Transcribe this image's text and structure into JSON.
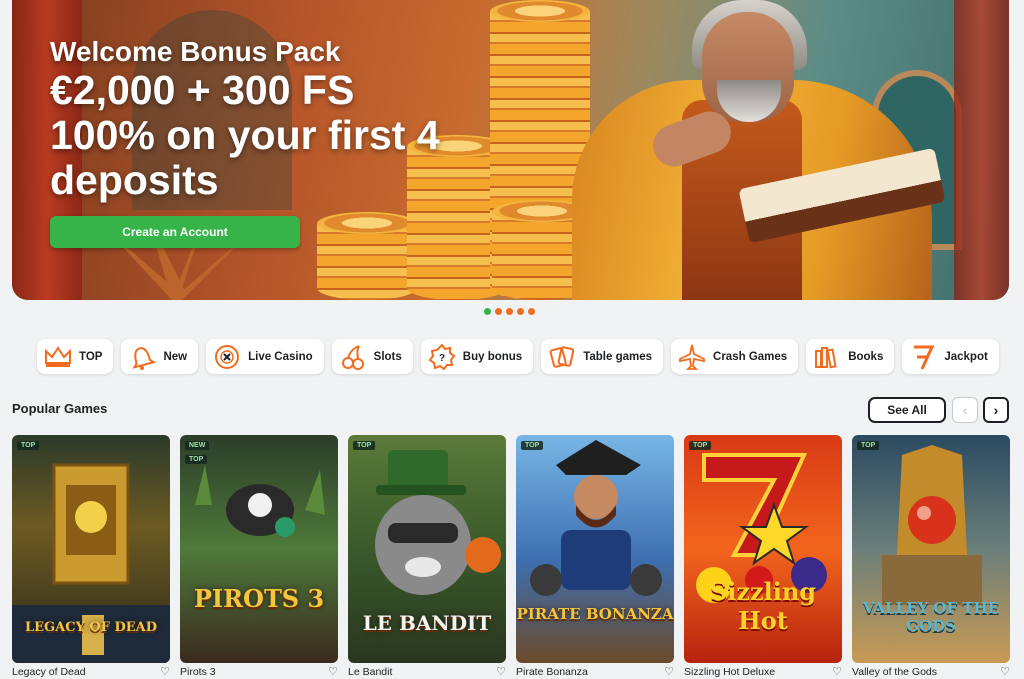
{
  "hero": {
    "subtitle": "Welcome Bonus Pack",
    "line1": "€2,000 + 300 FS",
    "line2": "100% on your first 4",
    "line3": "deposits",
    "cta_label": "Create an Account"
  },
  "carousel": {
    "slides": 5,
    "active_index": 0
  },
  "categories": [
    {
      "label": "TOP",
      "icon": "crown-icon"
    },
    {
      "label": "New",
      "icon": "bell-icon"
    },
    {
      "label": "Live Casino",
      "icon": "casino-chip-icon"
    },
    {
      "label": "Slots",
      "icon": "cherries-icon"
    },
    {
      "label": "Buy bonus",
      "icon": "bonus-badge-icon"
    },
    {
      "label": "Table games",
      "icon": "playing-cards-icon"
    },
    {
      "label": "Crash Games",
      "icon": "airplane-icon"
    },
    {
      "label": "Books",
      "icon": "books-icon"
    },
    {
      "label": "Jackpot",
      "icon": "seven-icon"
    }
  ],
  "popular": {
    "title": "Popular Games",
    "see_all": "See All",
    "prev": "‹",
    "next": "›"
  },
  "games": [
    {
      "name": "Legacy of Dead",
      "badges": [
        "TOP"
      ],
      "art": "LEGACY OF DEAD"
    },
    {
      "name": "Pirots 3",
      "badges": [
        "NEW",
        "TOP"
      ],
      "art": "PIROTS 3"
    },
    {
      "name": "Le Bandit",
      "badges": [
        "TOP"
      ],
      "art": "LE BANDIT"
    },
    {
      "name": "Pirate Bonanza",
      "badges": [
        "TOP"
      ],
      "art": "PIRATE BONANZA"
    },
    {
      "name": "Sizzling Hot Deluxe",
      "badges": [
        "TOP"
      ],
      "art": "Sizzling Hot"
    },
    {
      "name": "Valley of the Gods",
      "badges": [
        "TOP"
      ],
      "art": "VALLEY OF THE GODS"
    }
  ],
  "colors": {
    "accent_orange": "#f26c1f",
    "cta_green": "#36b44a",
    "background": "#f1f2f4"
  }
}
